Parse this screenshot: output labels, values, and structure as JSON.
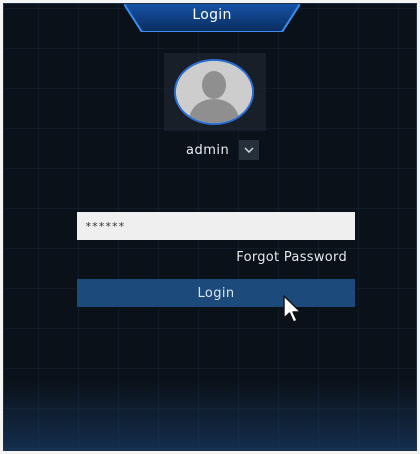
{
  "dialog": {
    "title": "Login"
  },
  "user": {
    "name": "admin",
    "avatar_icon": "user-silhouette-icon",
    "dropdown_icon": "chevron-down-icon"
  },
  "password": {
    "value": "******"
  },
  "links": {
    "forgot_password": "Forgot Password"
  },
  "actions": {
    "login_label": "Login"
  },
  "colors": {
    "background": "#0b1118",
    "accent": "#2a6fd1",
    "button": "#1c4a7a"
  }
}
